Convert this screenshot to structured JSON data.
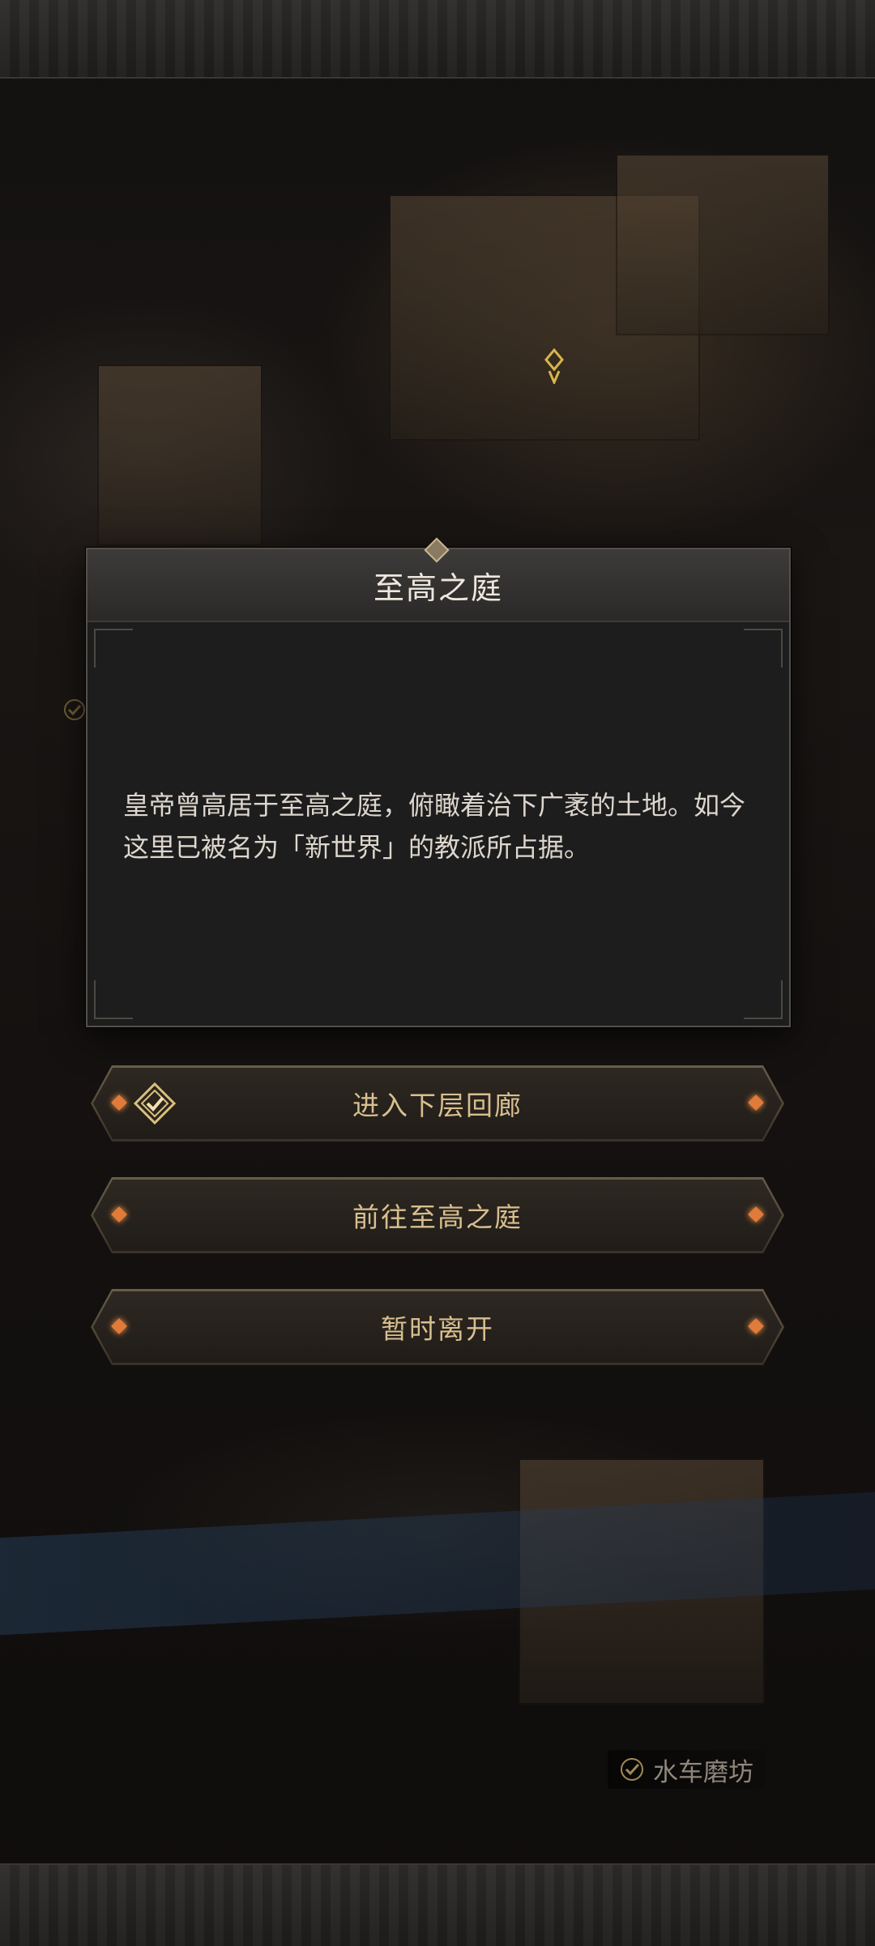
{
  "dialog": {
    "title": "至高之庭",
    "description": "皇帝曾高居于至高之庭，俯瞰着治下广袤的土地。如今这里已被名为「新世界」的教派所占据。"
  },
  "choices": [
    {
      "label": "进入下层回廊",
      "icon": "check-badge-icon"
    },
    {
      "label": "前往至高之庭"
    },
    {
      "label": "暂时离开"
    }
  ],
  "map_labels": [
    {
      "label": "水车磨坊",
      "icon": "check-icon"
    }
  ],
  "colors": {
    "accent_gold": "#d8bf8e",
    "gem_orange": "#e07b3a",
    "dialog_bg": "#1d1d1e"
  }
}
